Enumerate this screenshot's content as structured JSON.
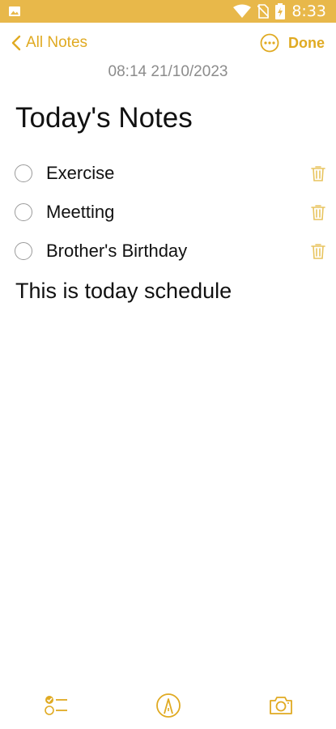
{
  "status_bar": {
    "time": "8:33",
    "background": "#E8B84A",
    "icons": [
      "image-icon",
      "wifi-icon",
      "no-sim-icon",
      "battery-charging-icon"
    ]
  },
  "nav": {
    "back_label": "All Notes",
    "done_label": "Done",
    "more_icon": "more-options-icon",
    "accent_color": "#E0AA22"
  },
  "note": {
    "datetime": "08:14 21/10/2023",
    "title": "Today's Notes",
    "todos": [
      {
        "text": "Exercise",
        "checked": false
      },
      {
        "text": "Meetting",
        "checked": false
      },
      {
        "text": "Brother's Birthday",
        "checked": false
      }
    ],
    "body": "This is today schedule"
  },
  "toolbar": {
    "items": [
      "checklist-icon",
      "markup-pen-icon",
      "camera-icon"
    ]
  }
}
